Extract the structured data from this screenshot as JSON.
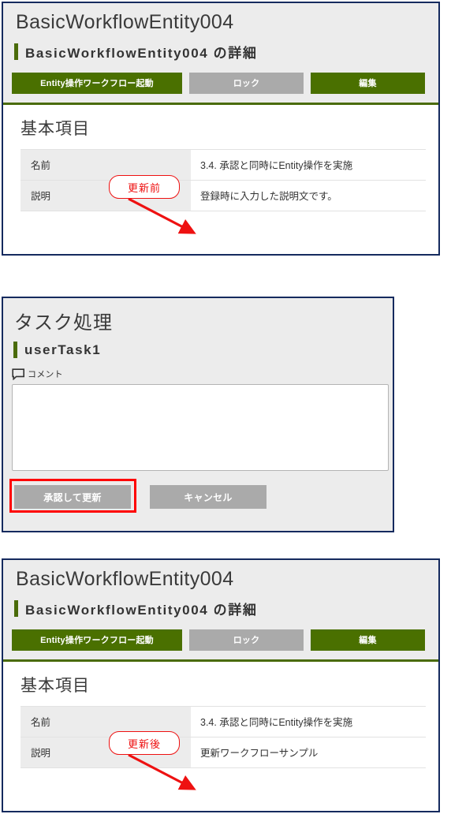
{
  "panels": {
    "before": {
      "page_title": "BasicWorkflowEntity004",
      "sub_title": "BasicWorkflowEntity004 の詳細",
      "buttons": {
        "workflow_start": "Entity操作ワークフロー起動",
        "lock": "ロック",
        "edit": "編集"
      },
      "section_title": "基本項目",
      "rows": [
        {
          "label": "名前",
          "value": "3.4. 承認と同時にEntity操作を実施"
        },
        {
          "label": "説明",
          "value": "登録時に入力した説明文です。"
        }
      ],
      "annotation": "更新前"
    },
    "task": {
      "page_title": "タスク処理",
      "sub_title": "userTask1",
      "comment_label": "コメント",
      "comment_icon": "speech-bubble-icon",
      "comment_value": "",
      "comment_placeholder": "",
      "buttons": {
        "approve_update": "承認して更新",
        "cancel": "キャンセル"
      }
    },
    "after": {
      "page_title": "BasicWorkflowEntity004",
      "sub_title": "BasicWorkflowEntity004 の詳細",
      "buttons": {
        "workflow_start": "Entity操作ワークフロー起動",
        "lock": "ロック",
        "edit": "編集"
      },
      "section_title": "基本項目",
      "rows": [
        {
          "label": "名前",
          "value": "3.4. 承認と同時にEntity操作を実施"
        },
        {
          "label": "説明",
          "value": "更新ワークフローサンプル"
        }
      ],
      "annotation": "更新後"
    }
  },
  "colors": {
    "panel_border": "#152a5e",
    "accent_green": "#4a6b0a",
    "button_green": "#4a7000",
    "button_gray": "#aaaaaa",
    "header_bg": "#ececec",
    "annotation_red": "#ee1111",
    "highlight_red": "#ff0000"
  }
}
